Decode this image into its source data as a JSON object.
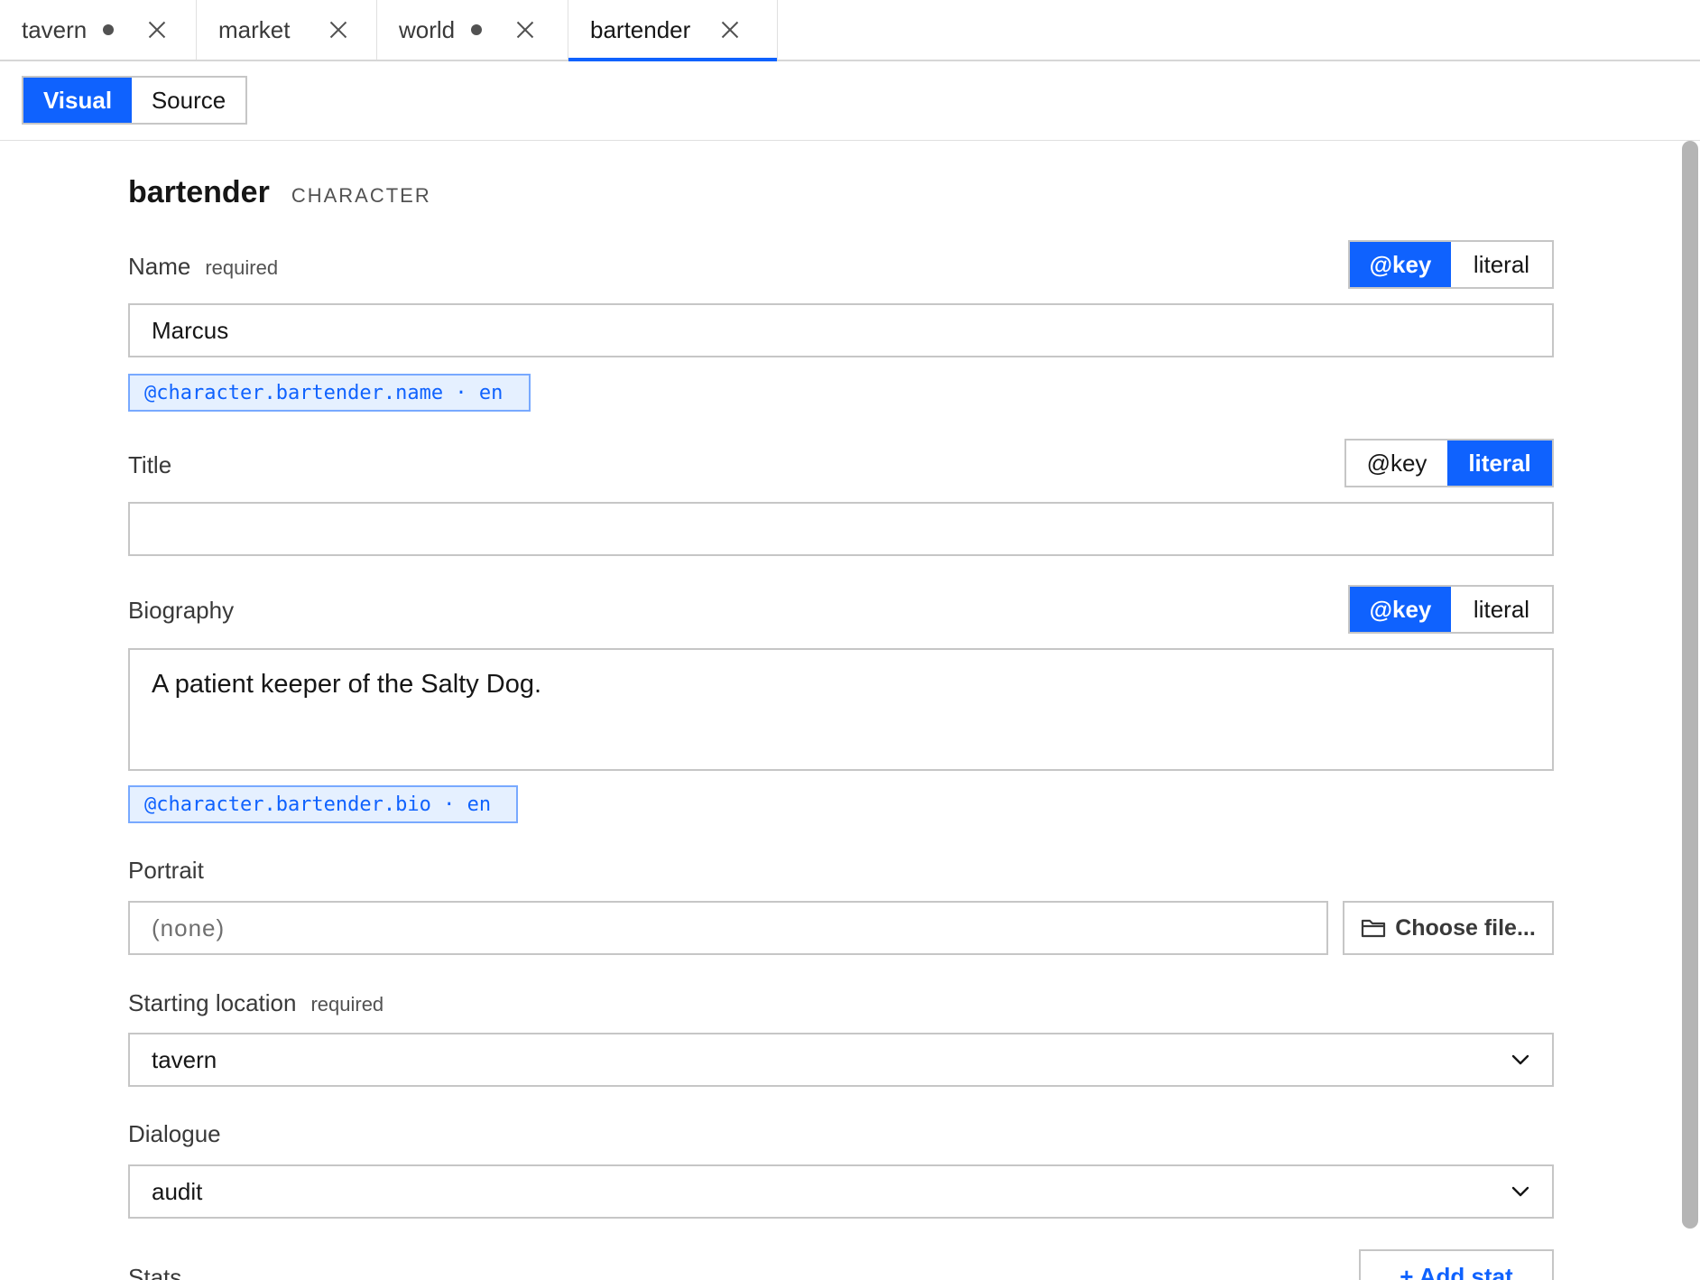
{
  "tabs": [
    {
      "label": "tavern",
      "modified": true,
      "active": false
    },
    {
      "label": "market",
      "modified": false,
      "active": false
    },
    {
      "label": "world",
      "modified": true,
      "active": false
    },
    {
      "label": "bartender",
      "modified": false,
      "active": true
    }
  ],
  "mode": {
    "visual_label": "Visual",
    "source_label": "Source",
    "selected": "Visual"
  },
  "entity": {
    "name": "bartender",
    "type": "CHARACTER"
  },
  "fields": {
    "name": {
      "label": "Name",
      "required_label": "required",
      "toggle": {
        "key_label": "@key",
        "literal_label": "literal",
        "selected": "@key"
      },
      "value": "Marcus",
      "key_ref": "@character.bartender.name · en"
    },
    "title": {
      "label": "Title",
      "toggle": {
        "key_label": "@key",
        "literal_label": "literal",
        "selected": "literal"
      },
      "value": ""
    },
    "biography": {
      "label": "Biography",
      "toggle": {
        "key_label": "@key",
        "literal_label": "literal",
        "selected": "@key"
      },
      "value": "A patient keeper of the Salty Dog.",
      "key_ref": "@character.bartender.bio · en"
    },
    "portrait": {
      "label": "Portrait",
      "placeholder": "(none)",
      "button_label": "Choose file..."
    },
    "starting_location": {
      "label": "Starting location",
      "required_label": "required",
      "value": "tavern"
    },
    "dialogue": {
      "label": "Dialogue",
      "value": "audit"
    },
    "stats": {
      "label": "Stats",
      "add_label": "+ Add stat"
    }
  },
  "icons": {
    "close": "close-icon",
    "modified": "modified-dot-icon",
    "folder": "folder-icon",
    "chevron": "chevron-down-icon"
  },
  "colors": {
    "accent": "#0f62fe",
    "border": "#c6c6c6",
    "chip_bg": "#e5f0ff"
  }
}
